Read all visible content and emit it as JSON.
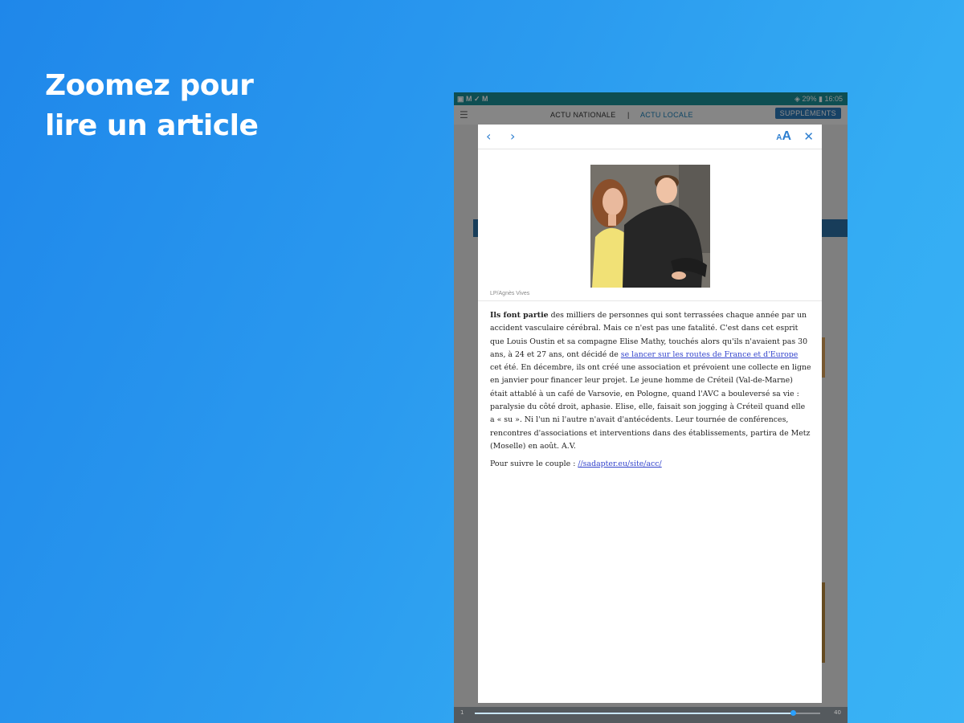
{
  "promo": {
    "headline_line1": "Zoomez pour",
    "headline_line2": "lire un article"
  },
  "statusbar": {
    "left_icons": "▣ M ✓ M",
    "battery": "29%",
    "time": "16:05"
  },
  "appbar": {
    "nav_national": "ACTU NATIONALE",
    "separator": "|",
    "nav_locale": "ACTU LOCALE",
    "supplements": "SUPPLÉMENTS"
  },
  "article": {
    "prev_icon": "chevron-left-icon",
    "next_icon": "chevron-right-icon",
    "font_size_label_small": "A",
    "font_size_label_big": "A",
    "close_label": "✕",
    "photo_credit": "LP/Agnès Vives",
    "lead_bold": "Ils font partie",
    "paragraph_1_start": " des milliers de personnes qui sont terrassées chaque année par un accident vasculaire cérébral. Mais ce n'est pas une fatalité. C'est dans cet esprit que Louis Oustin et sa compagne Elise Mathy, touchés alors qu'ils n'avaient pas 30 ans, à 24 et 27 ans, ont décidé de ",
    "paragraph_1_link": "se lancer sur les routes de France et d'Europe",
    "paragraph_1_end": " cet été. En décembre, ils ont créé une association et prévoient une collecte en ligne en janvier pour financer leur projet. Le jeune homme de Créteil (Val-de-Marne) était attablé à un café de Varsovie, en Pologne, quand l'AVC a bouleversé sa vie : paralysie du côté droit, aphasie. Elise, elle, faisait son jogging à Créteil quand elle a « su ». Ni l'un ni l'autre n'avait d'antécédents. Leur tournée de conférences, rencontres d'associations et interventions dans des établissements, partira de Metz (Moselle) en août. A.V.",
    "paragraph_2_text": "Pour suivre le couple : ",
    "paragraph_2_link": "//sadapter.eu/site/acc/"
  },
  "reader": {
    "progress": 0.92,
    "page_left": "1",
    "page_right": "40"
  },
  "colors": {
    "background_start": "#1f87ea",
    "background_end": "#3ab3f5",
    "statusbar": "#1a8f96",
    "accent": "#2e7fd0",
    "link": "#3344cc"
  }
}
